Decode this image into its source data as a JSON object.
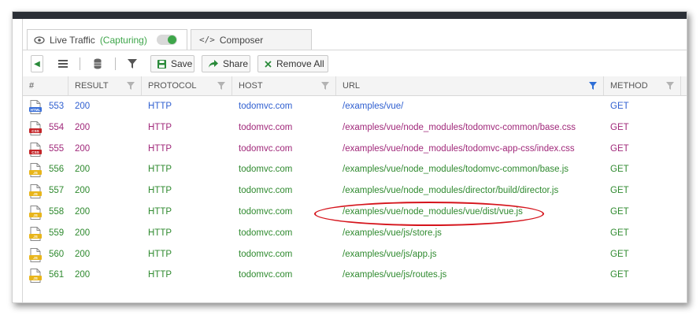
{
  "tabs": {
    "live_traffic": "Live Traffic",
    "capturing": "(Capturing)",
    "composer": "Composer"
  },
  "toolbar": {
    "save": "Save",
    "share": "Share",
    "remove_all": "Remove All"
  },
  "columns": {
    "num": "#",
    "result": "RESULT",
    "protocol": "PROTOCOL",
    "host": "HOST",
    "url": "URL",
    "method": "METHOD"
  },
  "rows": [
    {
      "num": "553",
      "result": "200",
      "protocol": "HTTP",
      "host": "todomvc.com",
      "url": "/examples/vue/",
      "method": "GET",
      "icon": "html-file-icon",
      "icon_label": "HTML",
      "color": "#2f5fd0"
    },
    {
      "num": "554",
      "result": "200",
      "protocol": "HTTP",
      "host": "todomvc.com",
      "url": "/examples/vue/node_modules/todomvc-common/base.css",
      "method": "GET",
      "icon": "css-file-icon",
      "icon_label": "CSS",
      "color": "#a0287a"
    },
    {
      "num": "555",
      "result": "200",
      "protocol": "HTTP",
      "host": "todomvc.com",
      "url": "/examples/vue/node_modules/todomvc-app-css/index.css",
      "method": "GET",
      "icon": "css-file-icon",
      "icon_label": "CSS",
      "color": "#a0287a"
    },
    {
      "num": "556",
      "result": "200",
      "protocol": "HTTP",
      "host": "todomvc.com",
      "url": "/examples/vue/node_modules/todomvc-common/base.js",
      "method": "GET",
      "icon": "js-file-icon",
      "icon_label": "JS",
      "color": "#2f8a2f"
    },
    {
      "num": "557",
      "result": "200",
      "protocol": "HTTP",
      "host": "todomvc.com",
      "url": "/examples/vue/node_modules/director/build/director.js",
      "method": "GET",
      "icon": "js-file-icon",
      "icon_label": "JS",
      "color": "#2f8a2f"
    },
    {
      "num": "558",
      "result": "200",
      "protocol": "HTTP",
      "host": "todomvc.com",
      "url": "/examples/vue/node_modules/vue/dist/vue.js",
      "method": "GET",
      "icon": "js-file-icon",
      "icon_label": "JS",
      "color": "#2f8a2f"
    },
    {
      "num": "559",
      "result": "200",
      "protocol": "HTTP",
      "host": "todomvc.com",
      "url": "/examples/vue/js/store.js",
      "method": "GET",
      "icon": "js-file-icon",
      "icon_label": "JS",
      "color": "#2f8a2f"
    },
    {
      "num": "560",
      "result": "200",
      "protocol": "HTTP",
      "host": "todomvc.com",
      "url": "/examples/vue/js/app.js",
      "method": "GET",
      "icon": "js-file-icon",
      "icon_label": "JS",
      "color": "#2f8a2f"
    },
    {
      "num": "561",
      "result": "200",
      "protocol": "HTTP",
      "host": "todomvc.com",
      "url": "/examples/vue/js/routes.js",
      "method": "GET",
      "icon": "js-file-icon",
      "icon_label": "JS",
      "color": "#2f8a2f"
    }
  ],
  "colors": {
    "accent_green": "#3ea64a",
    "highlight_ellipse": "#d5141c",
    "url_filter_active": "#2f6fd6"
  }
}
